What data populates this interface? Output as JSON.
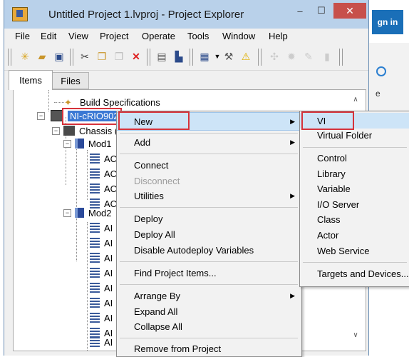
{
  "background_window": {
    "signin_label": "gn in",
    "partial_text": "e"
  },
  "window": {
    "title": "Untitled Project 1.lvproj - Project Explorer",
    "controls": {
      "minimize": "–",
      "maximize": "☐",
      "close": "✕"
    }
  },
  "menubar": [
    "File",
    "Edit",
    "View",
    "Project",
    "Operate",
    "Tools",
    "Window",
    "Help"
  ],
  "toolbar": {
    "icons": [
      "new-icon",
      "open-icon",
      "save-all-icon",
      "cut-icon",
      "copy-icon",
      "paste-icon",
      "delete-icon",
      "project-properties-icon",
      "save-icon",
      "view-icon",
      "build-icon",
      "warning-icon"
    ]
  },
  "tabs": [
    "Items",
    "Files"
  ],
  "tree": {
    "items": [
      {
        "label": "Build Specifications",
        "level": 2
      },
      {
        "label": "NI-cRIO902",
        "level": 1,
        "selected": true
      },
      {
        "label": "Chassis (",
        "level": 2
      },
      {
        "label": "Mod1",
        "level": 3
      },
      {
        "label": "AC",
        "level": 4
      },
      {
        "label": "AC",
        "level": 4
      },
      {
        "label": "AC",
        "level": 4
      },
      {
        "label": "AC",
        "level": 4
      },
      {
        "label": "Mod2",
        "level": 3
      },
      {
        "label": "AI",
        "level": 4
      },
      {
        "label": "AI",
        "level": 4
      },
      {
        "label": "AI",
        "level": 4
      },
      {
        "label": "AI",
        "level": 4
      },
      {
        "label": "AI",
        "level": 4
      },
      {
        "label": "AI",
        "level": 4
      },
      {
        "label": "AI",
        "level": 4
      },
      {
        "label": "AI",
        "level": 4
      },
      {
        "label": "AI",
        "level": 4
      }
    ]
  },
  "context_menu": {
    "items": [
      {
        "label": "New",
        "submenu": true,
        "highlighted": true
      },
      {
        "label": "Add",
        "submenu": true
      },
      {
        "label": "Connect"
      },
      {
        "label": "Disconnect",
        "disabled": true
      },
      {
        "label": "Utilities",
        "submenu": true
      },
      {
        "label": "Deploy"
      },
      {
        "label": "Deploy All"
      },
      {
        "label": "Disable Autodeploy Variables"
      },
      {
        "label": "Find Project Items..."
      },
      {
        "label": "Arrange By",
        "submenu": true
      },
      {
        "label": "Expand All"
      },
      {
        "label": "Collapse All"
      },
      {
        "label": "Remove from Project"
      }
    ]
  },
  "new_submenu": {
    "items": [
      {
        "label": "VI",
        "highlighted": true
      },
      {
        "label": "Virtual Folder"
      },
      {
        "label": "Control"
      },
      {
        "label": "Library"
      },
      {
        "label": "Variable"
      },
      {
        "label": "I/O Server"
      },
      {
        "label": "Class"
      },
      {
        "label": "Actor"
      },
      {
        "label": "Web Service"
      },
      {
        "label": "Targets and Devices..."
      }
    ]
  },
  "colors": {
    "highlight_box": "#d6323a",
    "menu_highlight": "#cde4f7",
    "title_bar": "#b9d1ea"
  }
}
